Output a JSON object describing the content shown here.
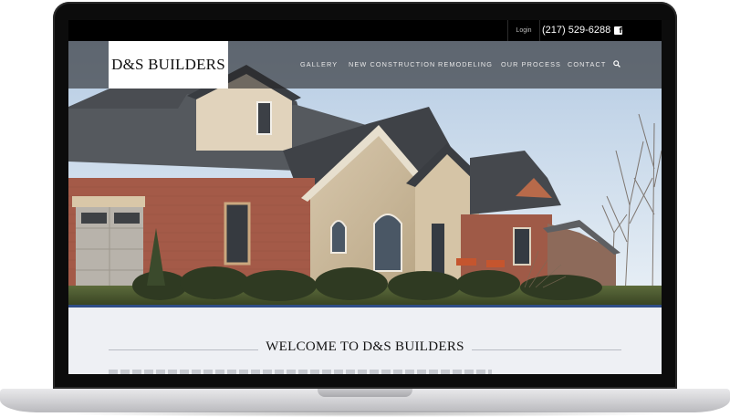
{
  "topbar": {
    "login_label": "Login",
    "phone": "(217) 529-6288",
    "social_icon": "facebook-icon",
    "social_glyph": "f"
  },
  "header": {
    "logo_text": "D&S BUILDERS",
    "nav": [
      {
        "label": "GALLERY"
      },
      {
        "label": "NEW CONSTRUCTION"
      },
      {
        "label": "REMODELING"
      },
      {
        "label": "OUR PROCESS"
      },
      {
        "label": "CONTACT"
      }
    ],
    "search_icon": "search-icon"
  },
  "hero": {
    "image": "house-photo",
    "accent_color": "#2f4d87"
  },
  "main": {
    "welcome_title": "WELCOME TO D&S BUILDERS"
  }
}
